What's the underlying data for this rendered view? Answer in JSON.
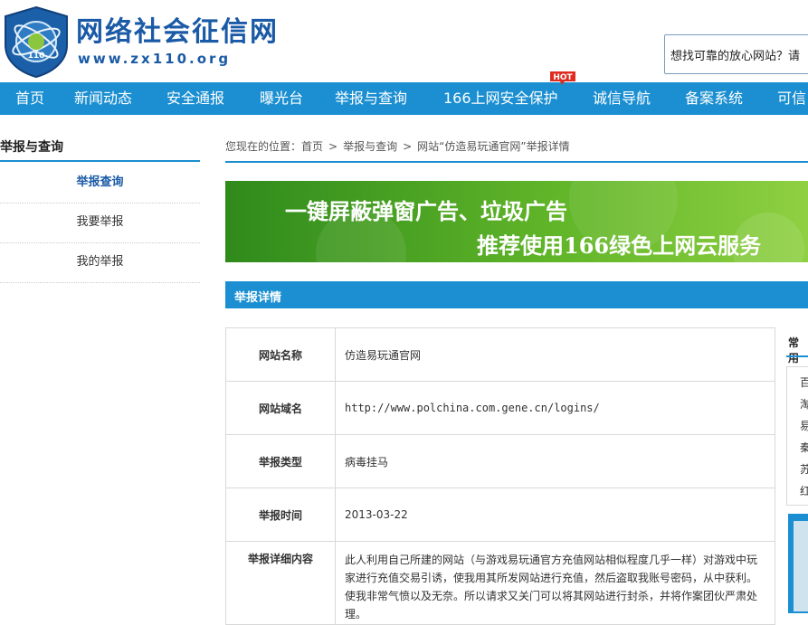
{
  "header": {
    "site_name": "网络社会征信网",
    "site_url": "www.zx110.org",
    "search_placeholder": "想找可靠的放心网站？请"
  },
  "nav": {
    "items": [
      "首页",
      "新闻动态",
      "安全通报",
      "曝光台",
      "举报与查询",
      "166上网安全保护",
      "诚信导航",
      "备案系统",
      "可信"
    ],
    "hot_badge": "HOT"
  },
  "sidebar": {
    "title": "举报与查询",
    "items": [
      "举报查询",
      "我要举报",
      "我的举报"
    ]
  },
  "breadcrumb": {
    "prefix": "您现在的位置：",
    "home": "首页",
    "level2": "举报与查询",
    "current": "网站“仿造易玩通官网”举报详情"
  },
  "banner": {
    "line1": "一键屏蔽弹窗广告、垃圾广告",
    "line2": "推荐使用166绿色上网云服务"
  },
  "section": {
    "title": "举报详情"
  },
  "detail": {
    "site_name_label": "网站名称",
    "site_name_value": "仿造易玩通官网",
    "domain_label": "网站域名",
    "domain_value": "http://www.polchina.com.gene.cn/logins/",
    "type_label": "举报类型",
    "type_value": "病毒挂马",
    "time_label": "举报时间",
    "time_value": "2013-03-22",
    "content_label": "举报详细内容",
    "content_value": "此人利用自己所建的网站（与游戏易玩通官方充值网站相似程度几乎一样）对游戏中玩家进行充值交易引诱，使我用其所发网站进行充值，然后盗取我账号密码，从中获利。使我非常气愤以及无奈。所以请求又关门可以将其网站进行封杀，并将作案团伙严肃处理。"
  },
  "right_panel": {
    "title": "常用",
    "items": [
      "百",
      "淘",
      "易",
      "秦",
      "苏",
      "红"
    ]
  }
}
